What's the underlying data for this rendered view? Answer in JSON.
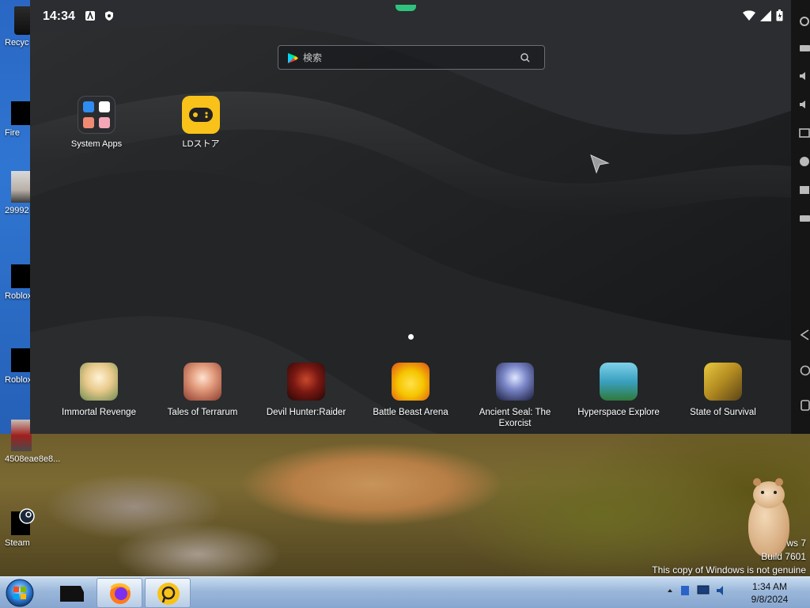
{
  "emulator": {
    "status_time": "14:34",
    "search": {
      "placeholder": "検索"
    },
    "top_apps": [
      {
        "label": "System Apps"
      },
      {
        "label": "LDストア"
      }
    ],
    "dock_apps": [
      {
        "label": "Immortal Revenge"
      },
      {
        "label": "Tales of Terrarum"
      },
      {
        "label": "Devil Hunter:Raider"
      },
      {
        "label": "Battle Beast Arena"
      },
      {
        "label": "Ancient Seal: The Exorcist"
      },
      {
        "label": "Hyperspace Explore"
      },
      {
        "label": "State of Survival"
      }
    ]
  },
  "desktop": {
    "icons": [
      {
        "label": "Recyc"
      },
      {
        "label": "Fire"
      },
      {
        "label": "29992"
      },
      {
        "label": "Roblox"
      },
      {
        "label": "Roblox"
      },
      {
        "label": "4508eae8e8..."
      },
      {
        "label": "Steam"
      }
    ],
    "watermark": {
      "line1": "ws 7",
      "line2": "Build 7601",
      "line3": "This copy of Windows is not genuine"
    }
  },
  "taskbar": {
    "time": "1:34 AM",
    "date": "9/8/2024"
  },
  "colors": {
    "ld_yellow": "#f8c21a",
    "emu_bg": "#1c1e20",
    "taskbar": "#9ab7da",
    "status_notch": "#2ec27e"
  }
}
